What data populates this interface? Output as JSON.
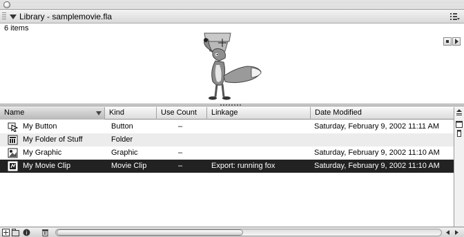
{
  "window": {
    "title": ""
  },
  "panel": {
    "title": "Library - samplemovie.fla",
    "item_count": "6 items"
  },
  "preview": {
    "symbol": "fox-character",
    "controls": [
      "stop",
      "play"
    ]
  },
  "columns": [
    {
      "label": "Name",
      "sorted": true
    },
    {
      "label": "Kind"
    },
    {
      "label": "Use Count"
    },
    {
      "label": "Linkage"
    },
    {
      "label": "Date Modified"
    }
  ],
  "items": [
    {
      "name": "My Button",
      "kind": "Button",
      "use_count": "–",
      "linkage": "",
      "date_modified": "Saturday, February 9, 2002  11:11 AM",
      "icon": "button-symbol-icon",
      "selected": false
    },
    {
      "name": "My Folder of Stuff",
      "kind": "Folder",
      "use_count": "",
      "linkage": "",
      "date_modified": "",
      "icon": "folder-icon",
      "selected": false
    },
    {
      "name": "My Graphic",
      "kind": "Graphic",
      "use_count": "–",
      "linkage": "",
      "date_modified": "Saturday, February 9, 2002  11:10 AM",
      "icon": "graphic-symbol-icon",
      "selected": false
    },
    {
      "name": "My Movie Clip",
      "kind": "Movie Clip",
      "use_count": "–",
      "linkage": "Export: running fox",
      "date_modified": "Saturday, February 9, 2002  11:10 AM",
      "icon": "movie-clip-symbol-icon",
      "selected": true
    }
  ],
  "toolbar": {
    "buttons": [
      "new-symbol-icon",
      "new-folder-icon",
      "properties-icon",
      "delete-icon"
    ]
  },
  "colors": {
    "selection": "#222222",
    "alt_row": "#ececec"
  }
}
